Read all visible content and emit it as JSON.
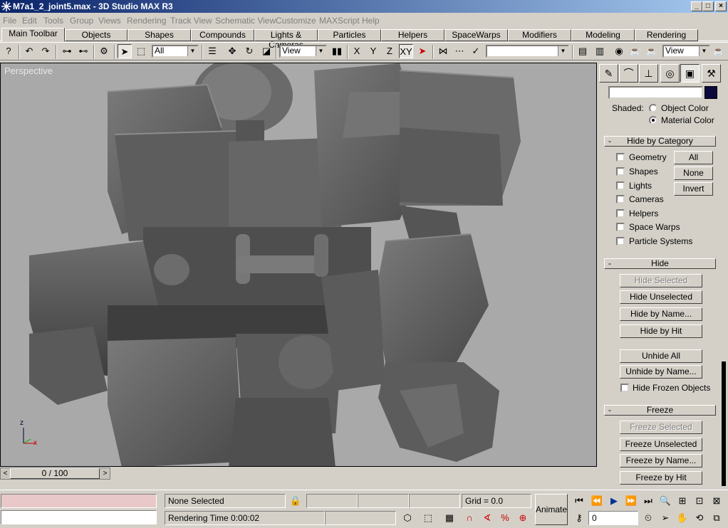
{
  "window": {
    "title": "M7a1_2_joint5.max - 3D Studio MAX R3",
    "minimize": "_",
    "maximize": "□",
    "close": "×"
  },
  "menu": [
    "File",
    "Edit",
    "Tools",
    "Group",
    "Views",
    "Rendering",
    "Track View",
    "Schematic View",
    "Customize",
    "MAXScript",
    "Help"
  ],
  "tabs": [
    "Main Toolbar",
    "Objects",
    "Shapes",
    "Compounds",
    "Lights & Cameras",
    "Particles",
    "Helpers",
    "SpaceWarps",
    "Modifiers",
    "Modeling",
    "Rendering"
  ],
  "toolbar": {
    "selection_filter": "All",
    "ref_coord_1": "View",
    "ref_coord_2": "View",
    "axis_x": "X",
    "axis_y": "Y",
    "axis_z": "Z",
    "axis_xy": "XY",
    "named_selection": ""
  },
  "viewport": {
    "label": "Perspective",
    "axis_z": "z",
    "axis_x": "x"
  },
  "time_slider": {
    "value": "0 / 100",
    "left_arrow": "<",
    "right_arrow": ">"
  },
  "display_panel": {
    "shaded_label": "Shaded:",
    "object_color": "Object Color",
    "material_color": "Material Color",
    "hide_by_category": {
      "title": "Hide by Category",
      "collapse": "-",
      "items": [
        "Geometry",
        "Shapes",
        "Lights",
        "Cameras",
        "Helpers",
        "Space Warps",
        "Particle Systems"
      ],
      "all_button": "All",
      "none_button": "None",
      "invert_button": "Invert"
    },
    "hide": {
      "title": "Hide",
      "collapse": "-",
      "hide_selected": "Hide Selected",
      "hide_unselected": "Hide Unselected",
      "hide_by_name": "Hide by Name...",
      "hide_by_hit": "Hide by Hit",
      "unhide_all": "Unhide All",
      "unhide_by_name": "Unhide by Name...",
      "hide_frozen": "Hide Frozen Objects"
    },
    "freeze": {
      "title": "Freeze",
      "collapse": "-",
      "freeze_selected": "Freeze Selected",
      "freeze_unselected": "Freeze Unselected",
      "freeze_by_name": "Freeze by Name...",
      "freeze_by_hit": "Freeze by Hit"
    }
  },
  "status": {
    "selection": "None Selected",
    "grid": "Grid = 0.0",
    "rendering_time": "Rendering Time  0:00:02",
    "animate": "Animate",
    "frame": "0"
  }
}
